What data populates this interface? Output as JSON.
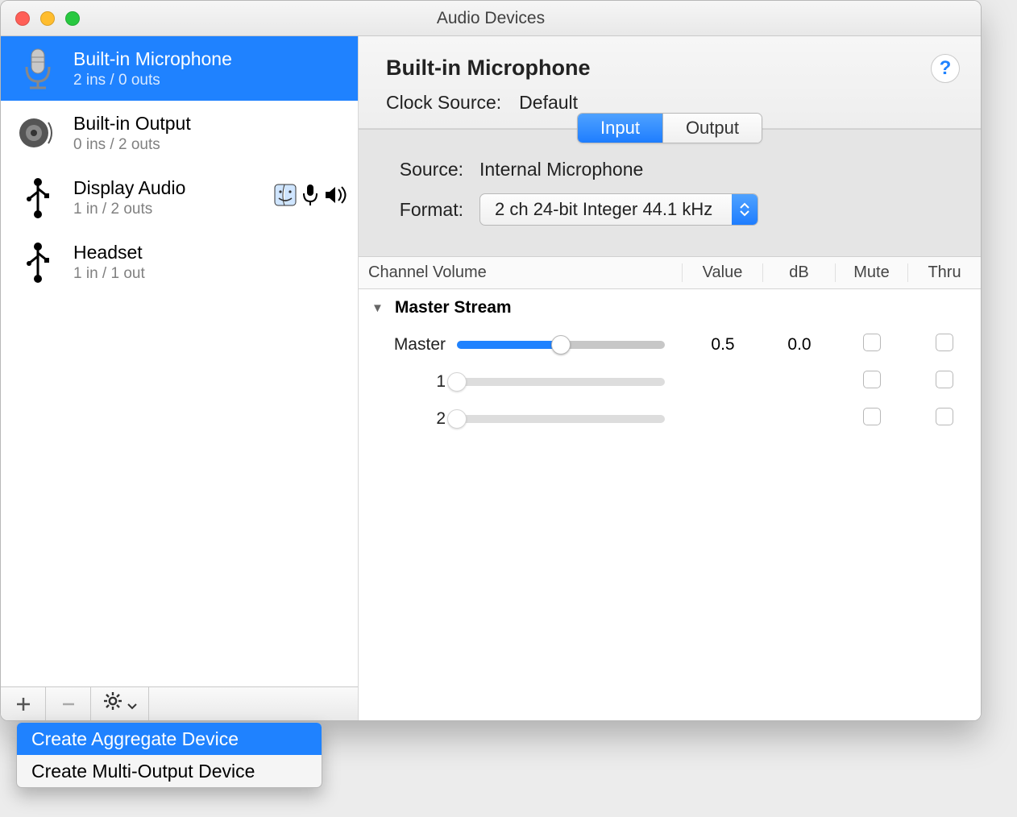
{
  "window": {
    "title": "Audio Devices"
  },
  "sidebar": {
    "devices": [
      {
        "name": "Built-in Microphone",
        "sub": "2 ins / 0 outs",
        "icon": "microphone-icon",
        "selected": true
      },
      {
        "name": "Built-in Output",
        "sub": "0 ins / 2 outs",
        "icon": "speaker-icon",
        "selected": false
      },
      {
        "name": "Display Audio",
        "sub": "1 in / 2 outs",
        "icon": "usb-icon",
        "selected": false,
        "badges": [
          "finder",
          "mic",
          "speaker"
        ]
      },
      {
        "name": "Headset",
        "sub": "1 in / 1 out",
        "icon": "usb-icon",
        "selected": false
      }
    ]
  },
  "detail": {
    "title": "Built-in Microphone",
    "clock_label": "Clock Source:",
    "clock_value": "Default",
    "tabs": {
      "input": "Input",
      "output": "Output",
      "active": "input"
    },
    "source_label": "Source:",
    "source_value": "Internal Microphone",
    "format_label": "Format:",
    "format_value": "2 ch 24-bit Integer 44.1 kHz",
    "table": {
      "headers": {
        "channel": "Channel Volume",
        "value": "Value",
        "db": "dB",
        "mute": "Mute",
        "thru": "Thru"
      },
      "stream_header": "Master Stream",
      "rows": [
        {
          "label": "Master",
          "value": "0.5",
          "db": "0.0",
          "slider": 0.5,
          "enabled": true
        },
        {
          "label": "1",
          "value": "",
          "db": "",
          "slider": 0.0,
          "enabled": false
        },
        {
          "label": "2",
          "value": "",
          "db": "",
          "slider": 0.0,
          "enabled": false
        }
      ]
    }
  },
  "popup": {
    "items": [
      {
        "label": "Create Aggregate Device",
        "selected": true
      },
      {
        "label": "Create Multi-Output Device",
        "selected": false
      }
    ]
  }
}
